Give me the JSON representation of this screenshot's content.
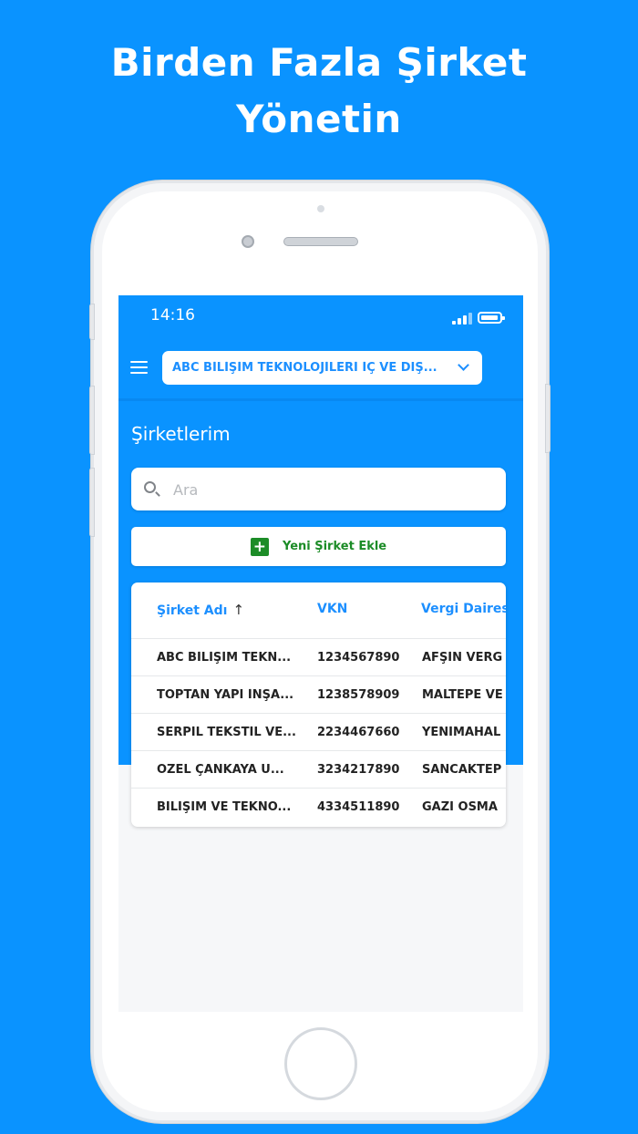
{
  "headline": {
    "line1": "Birden Fazla Şirket",
    "line2": "Yönetin"
  },
  "statusbar": {
    "time": "14:16"
  },
  "appbar": {
    "company_select_value": "ABC BİLİŞİM TEKNOLOJİLERİ İÇ VE DIŞ..."
  },
  "page": {
    "title": "Şirketlerim"
  },
  "search": {
    "placeholder": "Ara",
    "value": ""
  },
  "add_button": {
    "label": "Yeni Şirket Ekle"
  },
  "table": {
    "headers": {
      "name": "Şirket Adı",
      "vkn": "VKN",
      "vergi_dairesi": "Vergi Daires"
    },
    "rows": [
      {
        "name": "ABC BİLİŞİM TEKN...",
        "vkn": "1234567890",
        "vergi_dairesi": "AFŞİN VERG"
      },
      {
        "name": "TOPTAN YAPI İNŞA...",
        "vkn": "1238578909",
        "vergi_dairesi": "MALTEPE VE"
      },
      {
        "name": "SERPİL TEKSTİL VE...",
        "vkn": "2234467660",
        "vergi_dairesi": "YENİMAHAL"
      },
      {
        "name": "ÖZEL ÇANKAYA Ü...",
        "vkn": "3234217890",
        "vergi_dairesi": "SANCAKTEP"
      },
      {
        "name": "BİLİŞİM VE TEKNO...",
        "vkn": "4334511890",
        "vergi_dairesi": "GAZİ OSMA"
      }
    ]
  },
  "colors": {
    "brand_blue": "#0a93ff",
    "accent_green": "#1c8c27",
    "link_blue": "#1c8fff"
  },
  "icons": {
    "menu": "hamburger-icon",
    "dropdown": "chevron-down-icon",
    "search": "search-icon",
    "add": "plus-icon",
    "sort": "arrow-up-icon"
  }
}
